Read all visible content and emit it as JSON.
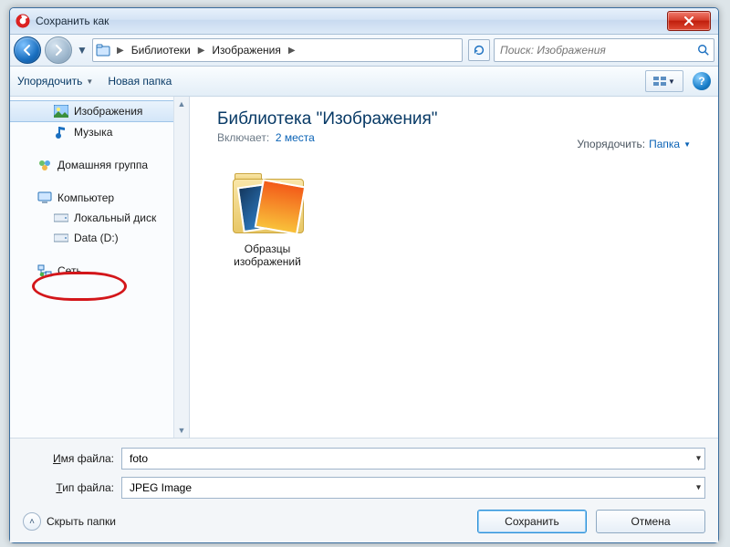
{
  "window": {
    "title": "Сохранить как"
  },
  "nav": {
    "breadcrumb": [
      "Библиотеки",
      "Изображения"
    ],
    "search_placeholder": "Поиск: Изображения"
  },
  "toolbar": {
    "organize": "Упорядочить",
    "new_folder": "Новая папка",
    "help_glyph": "?"
  },
  "sidebar": {
    "items": [
      {
        "label": "Изображения",
        "icon": "pictures",
        "selected": true,
        "indent": 1
      },
      {
        "label": "Музыка",
        "icon": "music",
        "indent": 1
      },
      {
        "label": "Домашняя группа",
        "icon": "homegroup",
        "indent": 0,
        "spacer_before": true
      },
      {
        "label": "Компьютер",
        "icon": "computer",
        "indent": 0,
        "spacer_before": true
      },
      {
        "label": "Локальный диск",
        "icon": "drive",
        "indent": 1
      },
      {
        "label": "Data (D:)",
        "icon": "drive",
        "indent": 1,
        "annotated": true
      },
      {
        "label": "Сеть",
        "icon": "network",
        "indent": 0,
        "spacer_before": true
      }
    ]
  },
  "main": {
    "library_title": "Библиотека \"Изображения\"",
    "includes_prefix": "Включает:",
    "includes_link": "2 места",
    "sort_label": "Упорядочить:",
    "sort_value": "Папка",
    "folder": {
      "line1": "Образцы",
      "line2": "изображений"
    }
  },
  "form": {
    "filename_label_pre": "",
    "filename_label_u": "И",
    "filename_label_post": "мя файла:",
    "filename_value": "foto",
    "filetype_label_pre": "",
    "filetype_label_u": "Т",
    "filetype_label_post": "ип файла:",
    "filetype_value": "JPEG Image"
  },
  "footer": {
    "hide_folders": "Скрыть папки",
    "save": "Сохранить",
    "cancel": "Отмена"
  }
}
